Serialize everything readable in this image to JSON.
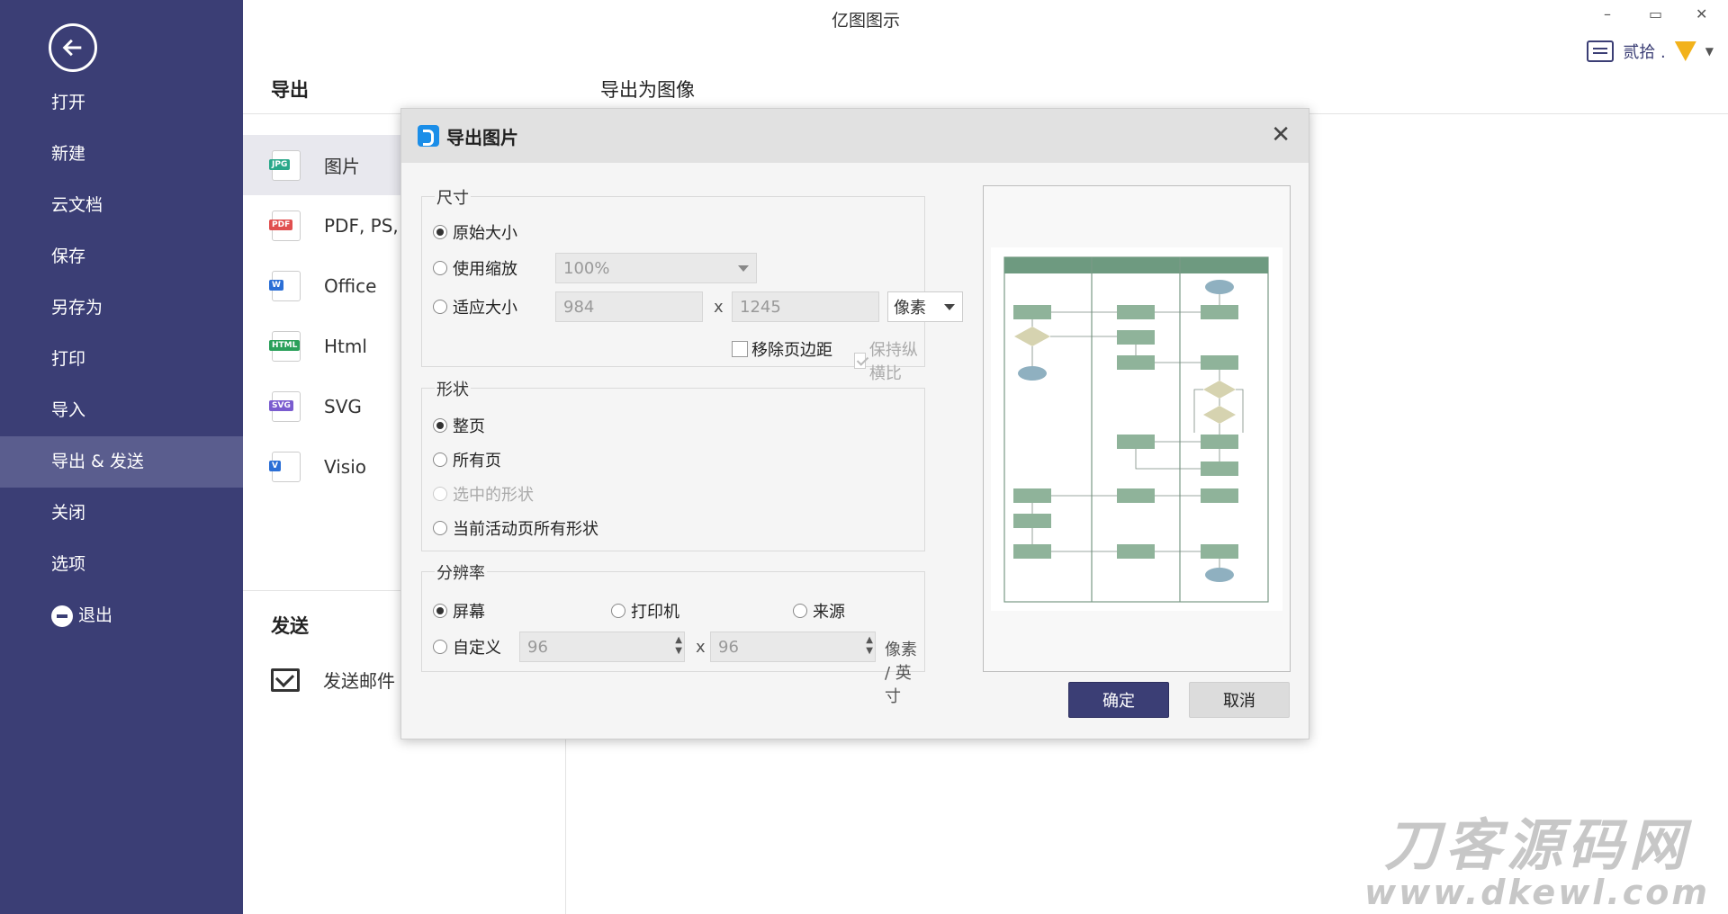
{
  "app": {
    "title": "亿图图示",
    "win_minimize": "–",
    "win_restore": "▭",
    "win_close": "✕",
    "user_name": "贰拾 ."
  },
  "sidebar": {
    "items": [
      {
        "label": "打开"
      },
      {
        "label": "新建"
      },
      {
        "label": "云文档"
      },
      {
        "label": "保存"
      },
      {
        "label": "另存为"
      },
      {
        "label": "打印"
      },
      {
        "label": "导入"
      },
      {
        "label": "导出 & 发送",
        "active": true
      },
      {
        "label": "关闭"
      },
      {
        "label": "选项"
      },
      {
        "label": "退出"
      }
    ]
  },
  "export": {
    "title": "导出",
    "subtitle": "导出为图像",
    "formats": [
      {
        "label": "图片",
        "badge": "JPG",
        "color": "#2aa88a",
        "active": true
      },
      {
        "label": "PDF, PS,",
        "badge": "PDF",
        "color": "#e04f4f"
      },
      {
        "label": "Office",
        "badge": "W",
        "color": "#2b6fd6"
      },
      {
        "label": "Html",
        "badge": "HTML",
        "color": "#2aa05a"
      },
      {
        "label": "SVG",
        "badge": "SVG",
        "color": "#7a5ccf"
      },
      {
        "label": "Visio",
        "badge": "V",
        "color": "#2b6fd6"
      }
    ],
    "send_title": "发送",
    "send_mail": "发送邮件"
  },
  "dialog": {
    "title": "导出图片",
    "close": "✕",
    "size": {
      "legend": "尺寸",
      "original": "原始大小",
      "scale": "使用缩放",
      "scale_value": "100%",
      "fit": "适应大小",
      "width": "984",
      "x": "x",
      "height": "1245",
      "unit": "像素",
      "remove_margin": "移除页边距",
      "keep_ratio": "保持纵横比"
    },
    "shape": {
      "legend": "形状",
      "whole_page": "整页",
      "all_pages": "所有页",
      "selected": "选中的形状",
      "active_page": "当前活动页所有形状"
    },
    "resolution": {
      "legend": "分辨率",
      "screen": "屏幕",
      "printer": "打印机",
      "source": "来源",
      "custom": "自定义",
      "dpi_x": "96",
      "x": "x",
      "dpi_y": "96",
      "unit": "像素 / 英寸"
    },
    "ok": "确定",
    "cancel": "取消"
  },
  "watermark": {
    "line1": "刀客源码网",
    "line2": "www.dkewl.com"
  },
  "colors": {
    "sidebar_bg": "#3b3e75",
    "primary_button": "#3b3e75",
    "flowchart_green": "#8fb39a",
    "flowchart_diamond": "#d6d3b0",
    "flowchart_ellipse": "#8fb0c0"
  }
}
